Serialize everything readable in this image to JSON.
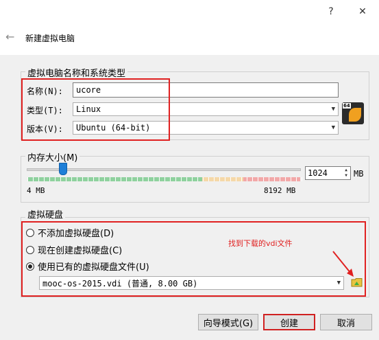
{
  "titlebar": {
    "help": "?",
    "close": "✕"
  },
  "wizard": {
    "title": "新建虚拟电脑"
  },
  "name_type": {
    "legend": "虚拟电脑名称和系统类型",
    "name_label": "名称(N):",
    "name_value": "ucore",
    "type_label": "类型(T):",
    "type_value": "Linux",
    "version_label": "版本(V):",
    "version_value": "Ubuntu (64-bit)",
    "os_badge": "64"
  },
  "memory": {
    "legend": "内存大小(M)",
    "value": "1024",
    "unit": "MB",
    "min_label": "4 MB",
    "max_label": "8192 MB",
    "slider_fraction": 0.125
  },
  "disk": {
    "legend": "虚拟硬盘",
    "option_none": "不添加虚拟硬盘(D)",
    "option_create": "现在创建虚拟硬盘(C)",
    "option_existing": "使用已有的虚拟硬盘文件(U)",
    "selected_file": "mooc-os-2015.vdi (普通, 8.00 GB)"
  },
  "annotation": "找到下载的vdi文件",
  "buttons": {
    "guided": "向导模式(G)",
    "create": "创建",
    "cancel": "取消"
  },
  "colors": {
    "annotation": "#e02020",
    "accent": "#1e7fd8",
    "scale_green": "#8fd19e",
    "scale_red": "#f2a8a8"
  }
}
